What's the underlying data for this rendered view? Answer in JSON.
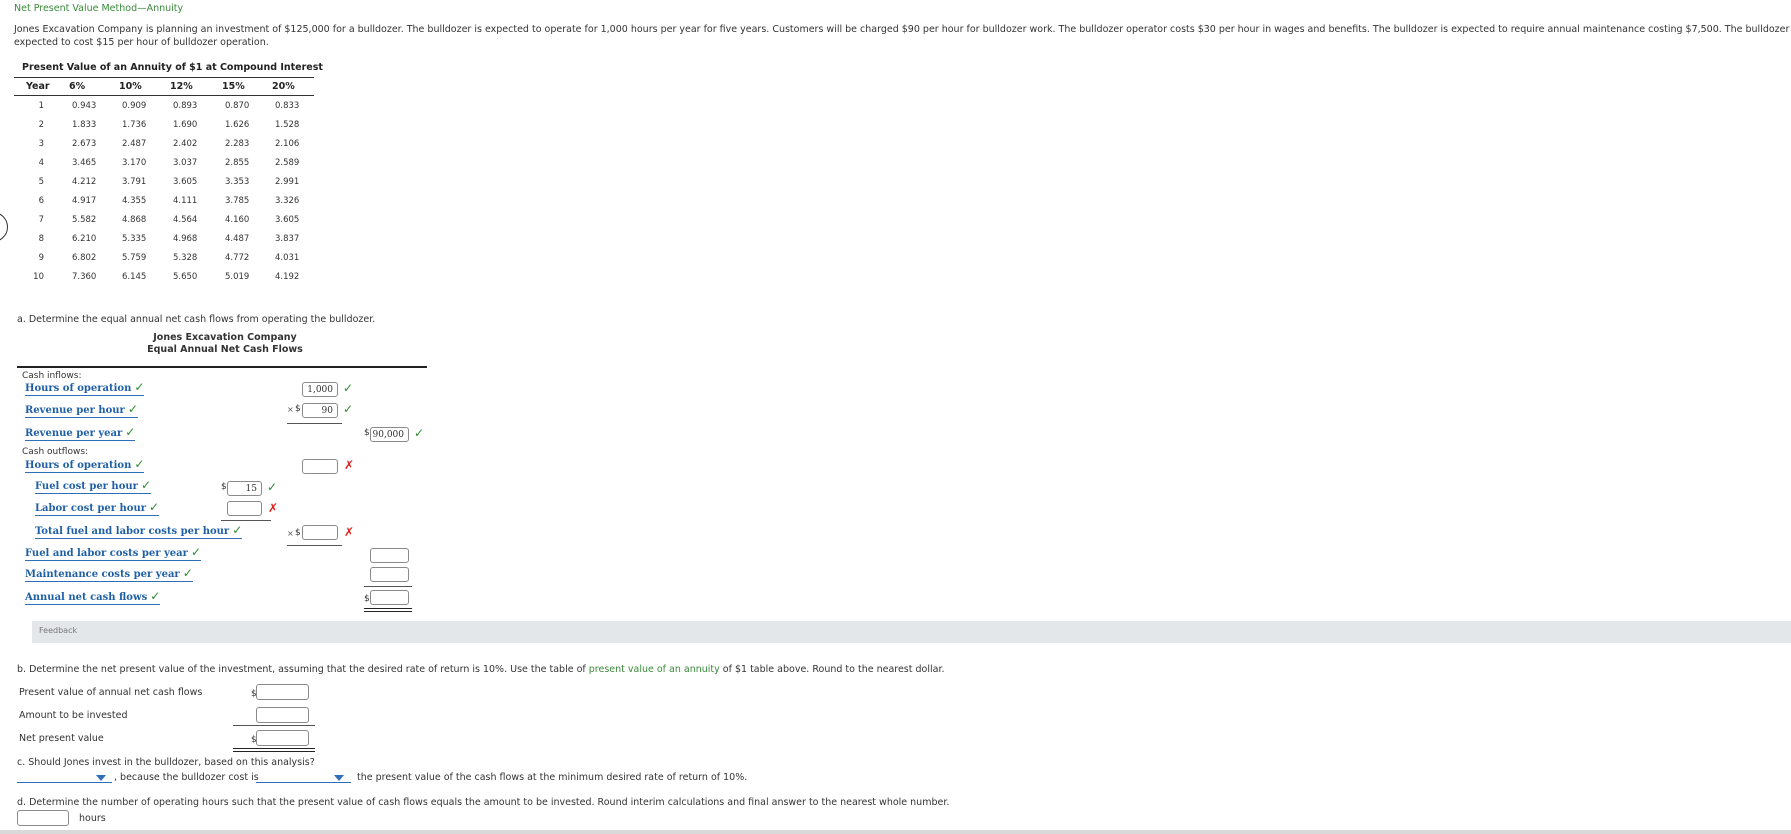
{
  "title": "Net Present Value Method—Annuity",
  "intro_line1": "Jones Excavation Company is planning an investment of $125,000 for a bulldozer. The bulldozer is expected to operate for 1,000 hours per year for five years. Customers will be charged $90 per hour for bulldozer work. The bulldozer operator costs $30 per hour in wages and benefits. The bulldozer is expected to require annual maintenance costing $7,500. The bulldozer uses fuel that is",
  "intro_line2": "expected to cost $15 per hour of bulldozer operation.",
  "pv_table": {
    "title": "Present Value of an Annuity of $1 at Compound Interest",
    "headers": [
      "Year",
      "6%",
      "10%",
      "12%",
      "15%",
      "20%"
    ],
    "rows": [
      [
        "1",
        "0.943",
        "0.909",
        "0.893",
        "0.870",
        "0.833"
      ],
      [
        "2",
        "1.833",
        "1.736",
        "1.690",
        "1.626",
        "1.528"
      ],
      [
        "3",
        "2.673",
        "2.487",
        "2.402",
        "2.283",
        "2.106"
      ],
      [
        "4",
        "3.465",
        "3.170",
        "3.037",
        "2.855",
        "2.589"
      ],
      [
        "5",
        "4.212",
        "3.791",
        "3.605",
        "3.353",
        "2.991"
      ],
      [
        "6",
        "4.917",
        "4.355",
        "4.111",
        "3.785",
        "3.326"
      ],
      [
        "7",
        "5.582",
        "4.868",
        "4.564",
        "4.160",
        "3.605"
      ],
      [
        "8",
        "6.210",
        "5.335",
        "4.968",
        "4.487",
        "3.837"
      ],
      [
        "9",
        "6.802",
        "5.759",
        "5.328",
        "4.772",
        "4.031"
      ],
      [
        "10",
        "7.360",
        "6.145",
        "5.650",
        "5.019",
        "4.192"
      ]
    ]
  },
  "part_a": {
    "prompt": "a. Determine the equal annual net cash flows from operating the bulldozer.",
    "company": "Jones Excavation Company",
    "subtitle": "Equal Annual Net Cash Flows",
    "cash_inflows_label": "Cash inflows:",
    "hours_of_operation": "Hours of operation",
    "revenue_per_hour": "Revenue per hour",
    "revenue_per_year": "Revenue per year",
    "cash_outflows_label": "Cash outflows:",
    "hours_of_operation_2": "Hours of operation",
    "fuel_cost_per_hour": "Fuel cost per hour",
    "labor_cost_per_hour": "Labor cost per hour",
    "total_fuel_labor_per_hour": "Total fuel and labor costs per hour",
    "fuel_labor_per_year": "Fuel and labor costs per year",
    "maintenance_per_year": "Maintenance costs per year",
    "annual_net_cash_flows": "Annual net cash flows",
    "hours_value": "1,000",
    "revenue_per_hour_value": "90",
    "revenue_per_year_value": "90,000",
    "hours_outflow_value": "",
    "fuel_value": "15",
    "labor_value": "",
    "total_per_hour_value": "",
    "fuel_labor_year_value": "",
    "maintenance_value": "",
    "net_value": "",
    "dollar": "$",
    "times": "×",
    "check": "✓",
    "cross": "✗",
    "feedback": "Feedback"
  },
  "part_b": {
    "prompt_pre": "b. Determine the net present value of the investment, assuming that the desired rate of return is 10%. Use the table of ",
    "prompt_link": "present value of an annuity",
    "prompt_post": " of $1 table above. Round to the nearest dollar.",
    "pv_label": "Present value of annual net cash flows",
    "invest_label": "Amount to be invested",
    "npv_label": "Net present value",
    "dollar": "$"
  },
  "part_c": {
    "prompt": "c. Should Jones invest in the bulldozer, based on this analysis?",
    "mid_text": ", because the bulldozer cost is",
    "end_text": "the present value of the cash flows at the minimum desired rate of return of 10%."
  },
  "part_d": {
    "prompt": "d. Determine the number of operating hours such that the present value of cash flows equals the amount to be invested. Round interim calculations and final answer to the nearest whole number.",
    "unit": "hours"
  }
}
